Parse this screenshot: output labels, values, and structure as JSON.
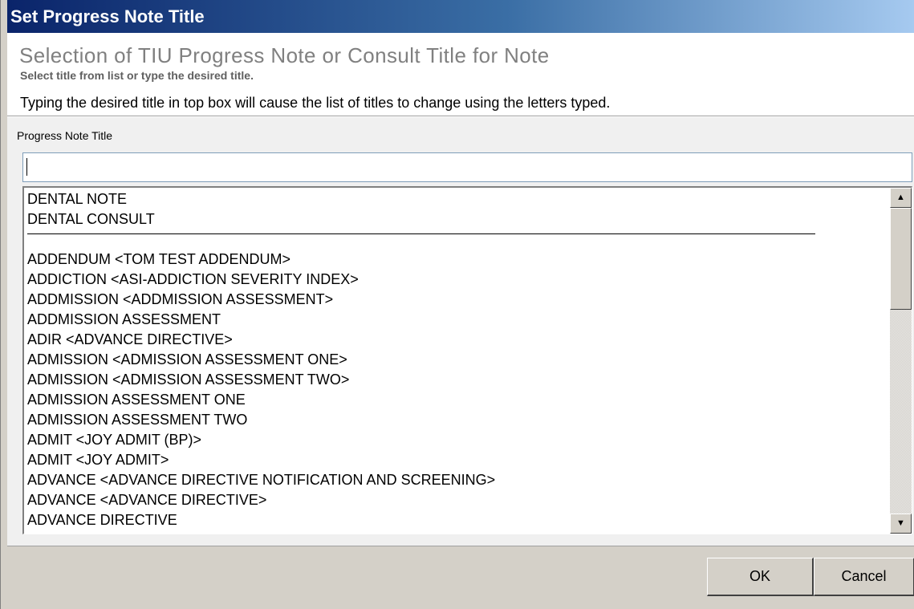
{
  "window": {
    "title": "Set Progress Note Title"
  },
  "header": {
    "heading": "Selection of TIU Progress Note or Consult Title for Note",
    "subheading": "Select title from list or type the desired title.",
    "instruction": "Typing the desired title in top box will cause the list of titles to change using the letters typed."
  },
  "title_field": {
    "label": "Progress Note Title",
    "value": "",
    "placeholder": ""
  },
  "title_list": {
    "items": [
      "DENTAL NOTE",
      "DENTAL CONSULT",
      "",
      "ADDENDUM  <TOM TEST ADDENDUM>",
      "ADDICTION  <ASI-ADDICTION SEVERITY INDEX>",
      "ADDMISSION  <ADDMISSION ASSESSMENT>",
      "ADDMISSION ASSESSMENT",
      "ADIR  <ADVANCE DIRECTIVE>",
      "ADMISSION  <ADMISSION ASSESSMENT ONE>",
      "ADMISSION  <ADMISSION ASSESSMENT TWO>",
      "ADMISSION ASSESSMENT ONE",
      "ADMISSION ASSESSMENT TWO",
      "ADMIT  <JOY ADMIT (BP)>",
      "ADMIT  <JOY ADMIT>",
      "ADVANCE  <ADVANCE DIRECTIVE NOTIFICATION AND SCREENING>",
      "ADVANCE  <ADVANCE DIRECTIVE>",
      "ADVANCE DIRECTIVE"
    ],
    "scrollbar": {
      "up_icon": "arrow-up-icon",
      "down_icon": "arrow-down-icon"
    }
  },
  "buttons": {
    "ok": "OK",
    "cancel": "Cancel"
  },
  "colors": {
    "title_bar_start": "#0a246a",
    "title_bar_end": "#a6caf0",
    "dialog_face": "#d4d0c8"
  }
}
